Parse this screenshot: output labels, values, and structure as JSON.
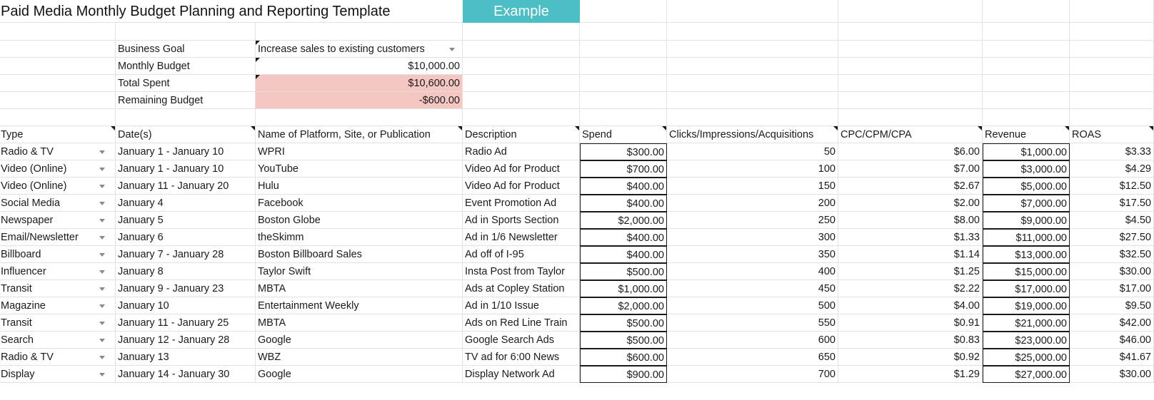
{
  "title": "Paid Media Monthly Budget Planning and Reporting Template",
  "example_button": "Example",
  "summary": {
    "business_goal_label": "Business Goal",
    "business_goal_value": "Increase sales to existing customers",
    "monthly_budget_label": "Monthly Budget",
    "monthly_budget_value": "$10,000.00",
    "total_spent_label": "Total Spent",
    "total_spent_value": "$10,600.00",
    "remaining_label": "Remaining Budget",
    "remaining_value": "-$600.00",
    "highlight_color": "#f4c7c3"
  },
  "table": {
    "headers": [
      "Type",
      "Date(s)",
      "Name of Platform, Site, or Publication",
      "Description",
      "Spend",
      "Clicks/Impressions/Acquisitions",
      "CPC/CPM/CPA",
      "Revenue",
      "ROAS"
    ],
    "rows": [
      [
        "Radio & TV",
        "January 1 - January 10",
        "WPRI",
        "Radio Ad",
        "$300.00",
        "50",
        "$6.00",
        "$1,000.00",
        "$3.33"
      ],
      [
        "Video (Online)",
        "January 1 - January 10",
        "YouTube",
        "Video Ad for Product",
        "$700.00",
        "100",
        "$7.00",
        "$3,000.00",
        "$4.29"
      ],
      [
        "Video (Online)",
        "January 11 - January 20",
        "Hulu",
        "Video Ad for Product",
        "$400.00",
        "150",
        "$2.67",
        "$5,000.00",
        "$12.50"
      ],
      [
        "Social Media",
        "January 4",
        "Facebook",
        "Event Promotion Ad",
        "$400.00",
        "200",
        "$2.00",
        "$7,000.00",
        "$17.50"
      ],
      [
        "Newspaper",
        "January 5",
        "Boston Globe",
        "Ad in Sports Section",
        "$2,000.00",
        "250",
        "$8.00",
        "$9,000.00",
        "$4.50"
      ],
      [
        "Email/Newsletter",
        "January 6",
        "theSkimm",
        "Ad in 1/6 Newsletter",
        "$400.00",
        "300",
        "$1.33",
        "$11,000.00",
        "$27.50"
      ],
      [
        "Billboard",
        "January 7 - January 28",
        "Boston Billboard Sales",
        "Ad off of I-95",
        "$400.00",
        "350",
        "$1.14",
        "$13,000.00",
        "$32.50"
      ],
      [
        "Influencer",
        "January 8",
        "Taylor Swift",
        "Insta Post from Taylor",
        "$500.00",
        "400",
        "$1.25",
        "$15,000.00",
        "$30.00"
      ],
      [
        "Transit",
        "January 9 - January 23",
        "MBTA",
        "Ads at Copley Station",
        "$1,000.00",
        "450",
        "$2.22",
        "$17,000.00",
        "$17.00"
      ],
      [
        "Magazine",
        "January 10",
        "Entertainment Weekly",
        "Ad in 1/10 Issue",
        "$2,000.00",
        "500",
        "$4.00",
        "$19,000.00",
        "$9.50"
      ],
      [
        "Transit",
        "January 11 - January 25",
        "MBTA",
        "Ads on Red Line Train",
        "$500.00",
        "550",
        "$0.91",
        "$21,000.00",
        "$42.00"
      ],
      [
        "Search",
        "January 12 - January 28",
        "Google",
        "Google Search Ads",
        "$500.00",
        "600",
        "$0.83",
        "$23,000.00",
        "$46.00"
      ],
      [
        "Radio & TV",
        "January 13",
        "WBZ",
        "TV ad for 6:00 News",
        "$600.00",
        "650",
        "$0.92",
        "$25,000.00",
        "$41.67"
      ],
      [
        "Display",
        "January 14 - January 30",
        "Google",
        "Display Network Ad",
        "$900.00",
        "700",
        "$1.29",
        "$27,000.00",
        "$30.00"
      ]
    ]
  }
}
